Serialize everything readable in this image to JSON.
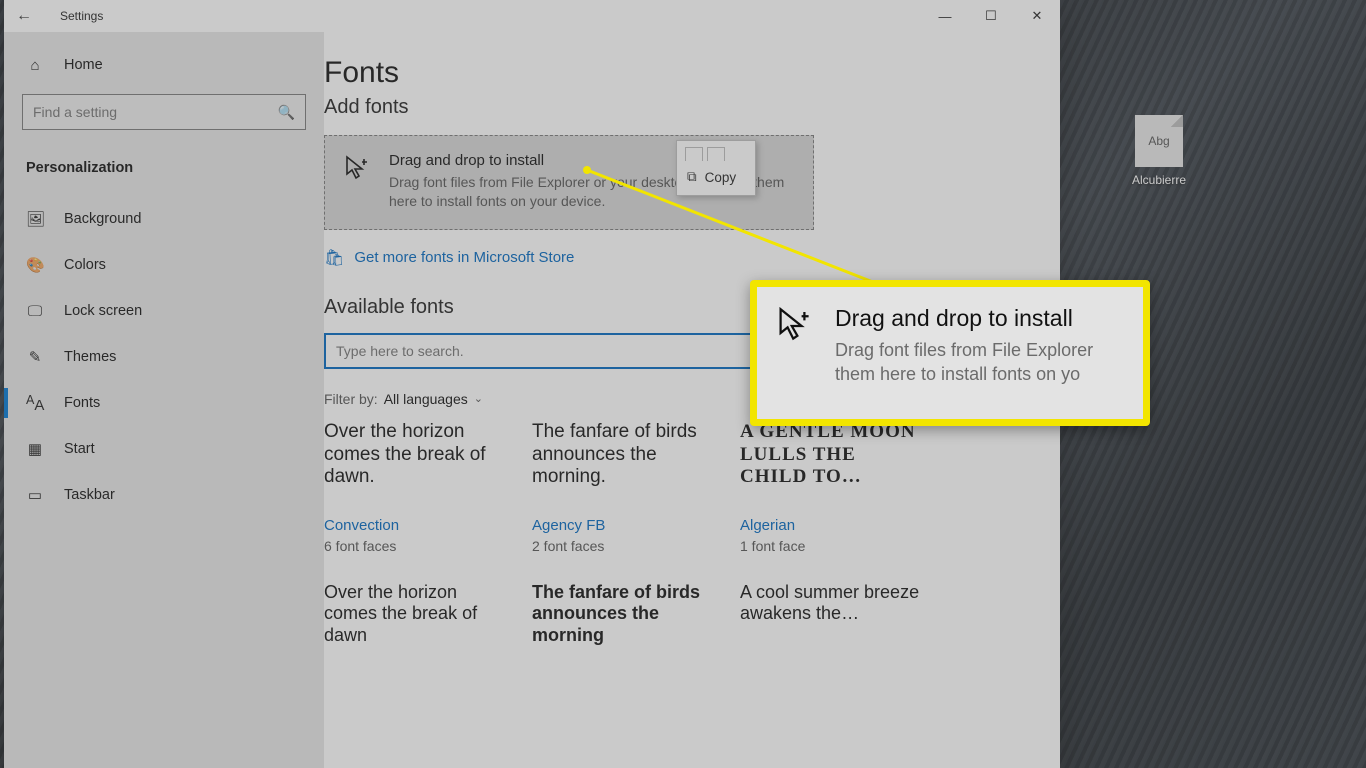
{
  "titlebar": {
    "title": "Settings"
  },
  "sidebar": {
    "home": "Home",
    "search_placeholder": "Find a setting",
    "category": "Personalization",
    "items": [
      {
        "label": "Background"
      },
      {
        "label": "Colors"
      },
      {
        "label": "Lock screen"
      },
      {
        "label": "Themes"
      },
      {
        "label": "Fonts"
      },
      {
        "label": "Start"
      },
      {
        "label": "Taskbar"
      }
    ]
  },
  "main": {
    "title": "Fonts",
    "add_fonts": "Add fonts",
    "dropzone": {
      "title": "Drag and drop to install",
      "sub": "Drag font files from File Explorer or your desktop and drop them here to install fonts on your device."
    },
    "store_link": "Get more fonts in Microsoft Store",
    "available": "Available fonts",
    "search_placeholder": "Type here to search.",
    "filter_label": "Filter by:",
    "filter_value": "All languages",
    "fonts_row1": [
      {
        "sample": "Over the horizon comes the break of dawn.",
        "name": "Convection",
        "faces": "6 font faces",
        "cls": ""
      },
      {
        "sample": "The fanfare of birds announces the morning.",
        "name": "Agency FB",
        "faces": "2 font faces",
        "cls": "agency"
      },
      {
        "sample": "A GENTLE MOON LULLS THE CHILD TO…",
        "name": "Algerian",
        "faces": "1 font face",
        "cls": "algerian"
      }
    ],
    "fonts_row2": [
      {
        "sample": "Over the horizon comes the break of dawn",
        "cls": ""
      },
      {
        "sample": "The fanfare of birds announces the morning",
        "cls": "bold"
      },
      {
        "sample": "A cool summer breeze awakens the…",
        "cls": ""
      }
    ]
  },
  "copy_popup": {
    "label": "Copy"
  },
  "callout": {
    "title": "Drag and drop to install",
    "sub1": "Drag font files from File Explorer",
    "sub2": "them here to install fonts on yo"
  },
  "desktop": {
    "file_glyph": "Abg",
    "file_name": "Alcubierre"
  }
}
